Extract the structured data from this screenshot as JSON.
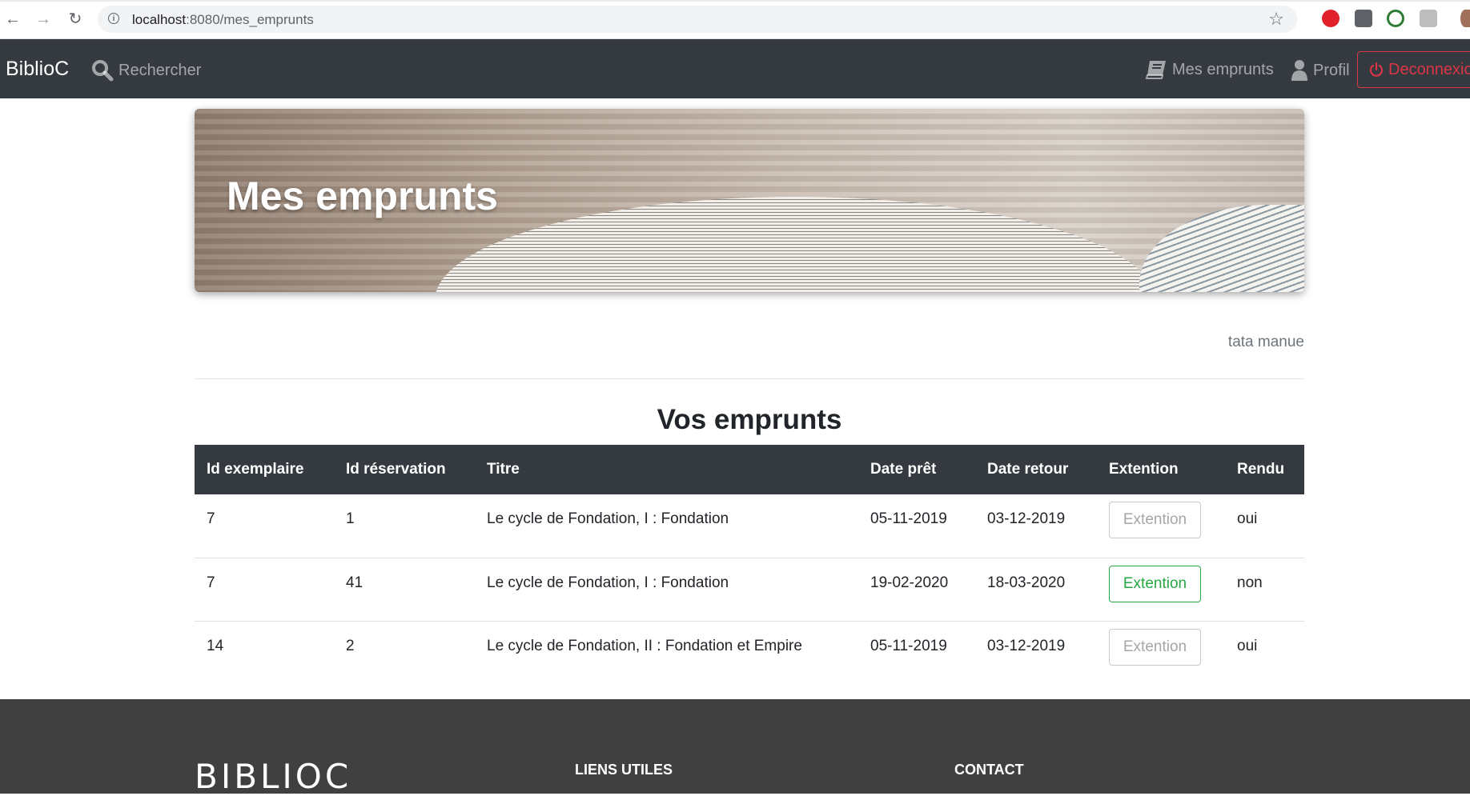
{
  "browser": {
    "url_host": "localhost",
    "url_path": ":8080/mes_emprunts"
  },
  "navbar": {
    "brand": "BiblioC",
    "search_label": "Rechercher",
    "loans_label": "Mes emprunts",
    "profile_label": "Profil",
    "logout_label": "Deconnexio"
  },
  "hero": {
    "title": "Mes emprunts"
  },
  "user": {
    "name": "tata manue"
  },
  "loans": {
    "title": "Vos emprunts",
    "columns": [
      "Id exemplaire",
      "Id réservation",
      "Titre",
      "Date prêt",
      "Date retour",
      "Extention",
      "Rendu"
    ],
    "rows": [
      {
        "id_exemplaire": "7",
        "id_reservation": "1",
        "titre": "Le cycle de Fondation, I : Fondation",
        "date_pret": "05-11-2019",
        "date_retour": "03-12-2019",
        "extention": "Extention",
        "extention_enabled": false,
        "rendu": "oui"
      },
      {
        "id_exemplaire": "7",
        "id_reservation": "41",
        "titre": "Le cycle de Fondation, I : Fondation",
        "date_pret": "19-02-2020",
        "date_retour": "18-03-2020",
        "extention": "Extention",
        "extention_enabled": true,
        "rendu": "non"
      },
      {
        "id_exemplaire": "14",
        "id_reservation": "2",
        "titre": "Le cycle de Fondation, II : Fondation et Empire",
        "date_pret": "05-11-2019",
        "date_retour": "03-12-2019",
        "extention": "Extention",
        "extention_enabled": false,
        "rendu": "oui"
      }
    ]
  },
  "footer": {
    "logo": "BIBLIOC",
    "links_title": "LIENS UTILES",
    "contact_title": "CONTACT"
  },
  "colors": {
    "navbar_bg": "#343a40",
    "danger": "#dc3545",
    "success": "#28a745",
    "footer_bg": "#404040"
  }
}
